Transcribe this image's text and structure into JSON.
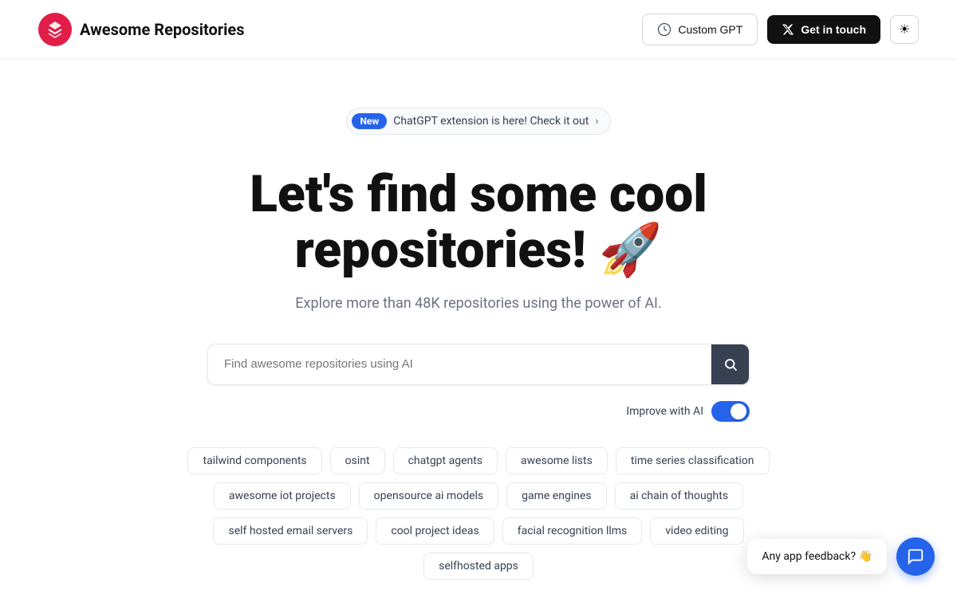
{
  "header": {
    "logo_text": "Awesome Repositories",
    "custom_gpt_label": "Custom GPT",
    "get_in_touch_label": "Get in touch",
    "theme_icon": "☀"
  },
  "banner": {
    "new_label": "New",
    "text": "ChatGPT extension is here! Check it out",
    "chevron": "›"
  },
  "hero": {
    "title": "Let's find some cool repositories! 🚀",
    "subtitle": "Explore more than 48K repositories using the power of AI."
  },
  "search": {
    "placeholder": "Find awesome repositories using AI",
    "button_icon": "🔍"
  },
  "ai_toggle": {
    "label": "Improve with AI",
    "enabled": true
  },
  "tags": [
    "tailwind components",
    "osint",
    "chatgpt agents",
    "awesome lists",
    "time series classification",
    "awesome iot projects",
    "opensource ai models",
    "game engines",
    "ai chain of thoughts",
    "self hosted email servers",
    "cool project ideas",
    "facial recognition llms",
    "video editing",
    "selfhosted apps"
  ],
  "feedback": {
    "bubble_text": "Any app feedback? 👋",
    "chat_icon": "💬"
  }
}
